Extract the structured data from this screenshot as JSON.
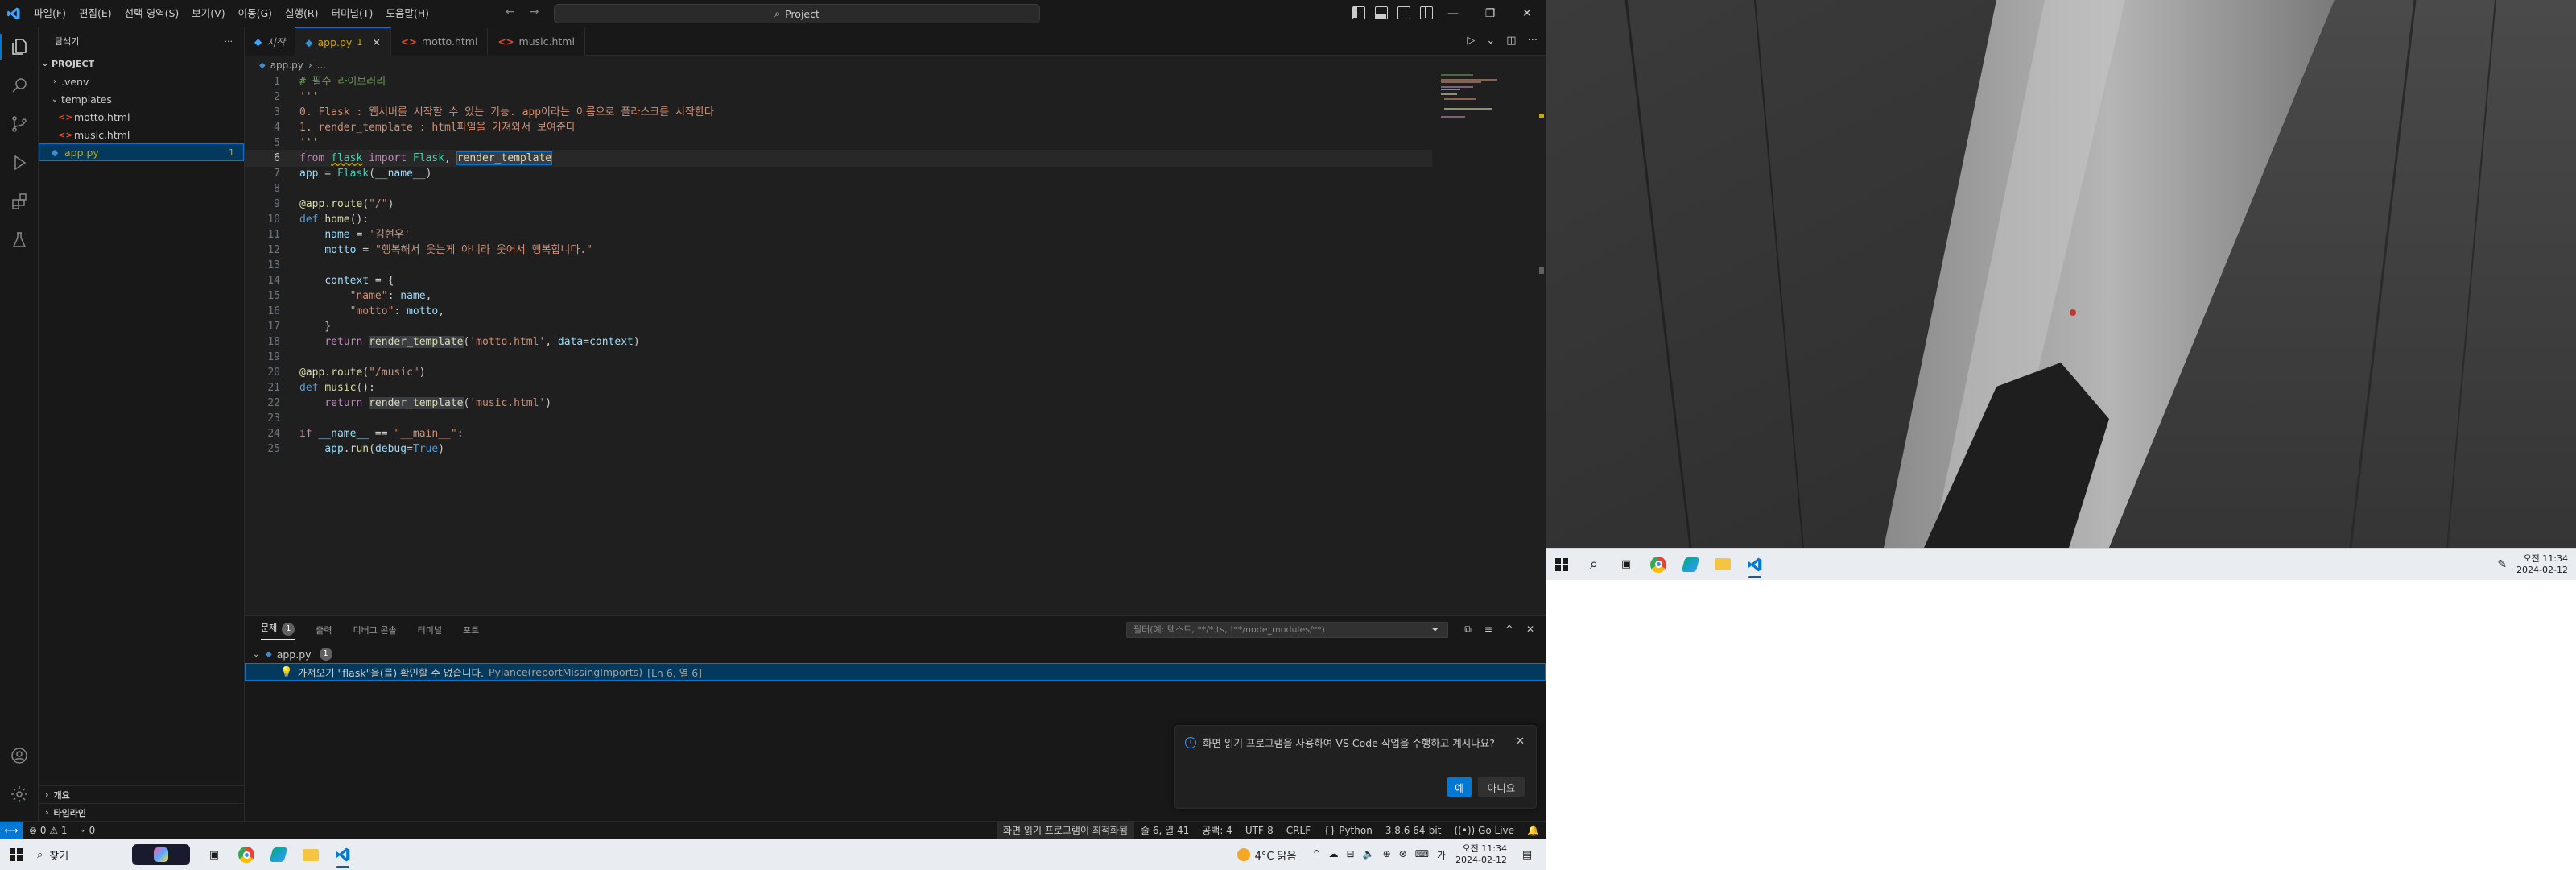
{
  "titlebar": {
    "menus": [
      "파일(F)",
      "편집(E)",
      "선택 영역(S)",
      "보기(V)",
      "이동(G)",
      "실행(R)",
      "터미널(T)",
      "도움말(H)"
    ],
    "command_center": "Project"
  },
  "explorer": {
    "header": "탐색기",
    "project": "PROJECT",
    "items": {
      "venv": ".venv",
      "templates": "templates",
      "motto": "motto.html",
      "music": "music.html",
      "app": "app.py",
      "app_badge": "1"
    },
    "outline": "개요",
    "timeline": "타임라인"
  },
  "tabs": [
    {
      "label": "시작"
    },
    {
      "label": "app.py",
      "badge": "1"
    },
    {
      "label": "motto.html"
    },
    {
      "label": "music.html"
    }
  ],
  "breadcrumb": {
    "file": "app.py",
    "rest": "..."
  },
  "code": [
    "# 필수 라이브러리",
    "'''",
    "0. Flask : 웹서버를 시작할 수 있는 기능. app이라는 이름으로 플라스크를 시작한다",
    "1. render_template : html파일을 가져와서 보여준다",
    "'''",
    "from flask import Flask, render_template",
    "app = Flask(__name__)",
    "",
    "@app.route(\"/\")",
    "def home():",
    "    name = '김현우'",
    "    motto = \"행복해서 웃는게 아니라 웃어서 행복합니다.\"",
    "",
    "    context = {",
    "        \"name\": name,",
    "        \"motto\": motto,",
    "    }",
    "    return render_template('motto.html', data=context)",
    "",
    "@app.route(\"/music\")",
    "def music():",
    "    return render_template('music.html')",
    "",
    "if __name__ == \"__main__\":",
    "    app.run(debug=True)"
  ],
  "panel": {
    "tabs": [
      "문제",
      "출력",
      "디버그 콘솔",
      "터미널",
      "포트"
    ],
    "problems_count": "1",
    "filter_placeholder": "필터(예: 텍스트, **/*.ts, !**/node_modules/**)",
    "file": "app.py",
    "file_count": "1",
    "problem": "가져오기 \"flask\"을(를) 확인할 수 없습니다.",
    "source": "Pylance(reportMissingImports)",
    "location": "[Ln 6, 열 6]"
  },
  "toast": {
    "message": "화면 읽기 프로그램을 사용하여 VS Code 작업을 수행하고 계시나요?",
    "yes": "예",
    "no": "아니요"
  },
  "statusbar": {
    "problems": "⊗ 0 ⚠ 1",
    "ports": "0",
    "screen_reader": "화면 읽기 프로그램이 최적화됨",
    "position": "줄 6, 열 41",
    "spaces": "공백: 4",
    "encoding": "UTF-8",
    "eol": "CRLF",
    "language": "Python",
    "interpreter": "3.8.6 64-bit",
    "golive": "Go Live"
  },
  "taskbar": {
    "search": "찾기",
    "weather": "4°C 맑음",
    "time": "오전 11:34",
    "date": "2024-02-12"
  },
  "taskbar2": {
    "time": "오전 11:34",
    "date": "2024-02-12"
  },
  "colors": {
    "accent": "#0078d4",
    "editor_bg": "#1f1f1f",
    "sidebar_bg": "#181818"
  }
}
